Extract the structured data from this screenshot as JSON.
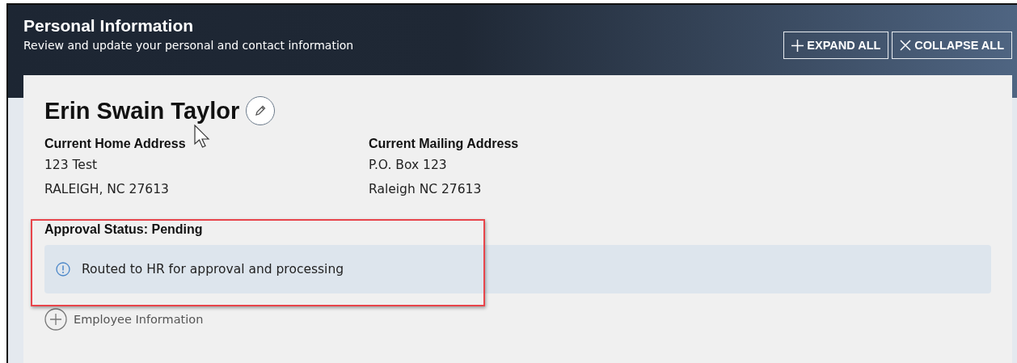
{
  "header": {
    "title": "Personal Information",
    "subtitle": "Review and update your personal and contact information",
    "buttons": [
      {
        "kind": "expand",
        "label": "EXPAND ALL"
      },
      {
        "kind": "collapse",
        "label": "COLLAPSE ALL"
      }
    ]
  },
  "person": {
    "name": "Erin Swain Taylor"
  },
  "addresses": [
    {
      "label": "Current Home Address",
      "lines": [
        "123 Test",
        "RALEIGH, NC 27613"
      ]
    },
    {
      "label": "Current Mailing Address",
      "lines": [
        "P.O. Box 123",
        "Raleigh NC 27613"
      ]
    }
  ],
  "approval": {
    "status": "Approval Status: Pending",
    "message": "Routed to HR for approval and processing",
    "highlighted": true
  },
  "sections": [
    {
      "label": "Employee Information",
      "expanded": false
    }
  ]
}
